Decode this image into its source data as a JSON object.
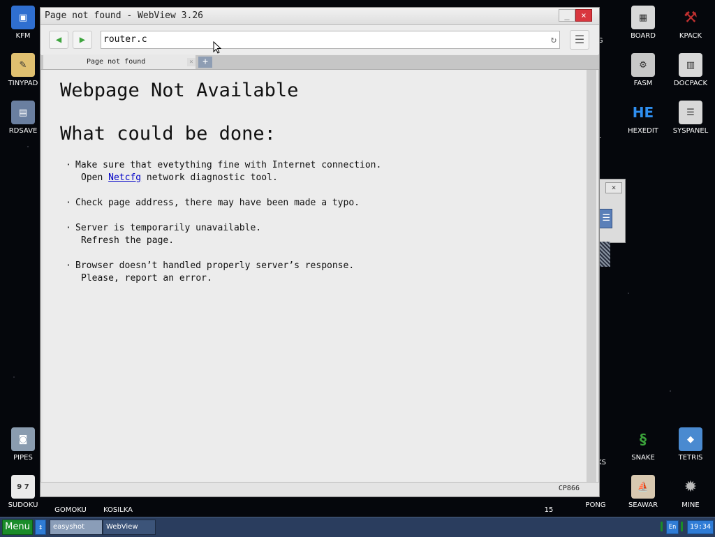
{
  "desktop": {
    "icons_left": [
      {
        "label": "KFM",
        "icon": "floppy-disk-icon",
        "color": "#2f6fd0"
      },
      {
        "label": "TINYPAD",
        "icon": "notepad-icon",
        "color": "#e0c070"
      },
      {
        "label": "RDSAVE",
        "icon": "ramdisk-save-icon",
        "color": "#6a7fa0"
      },
      {
        "label": "PIPES",
        "icon": "pipes-game-icon",
        "color": "#8a9caf"
      },
      {
        "label": "SUDOKU",
        "icon": "sudoku-grid-icon",
        "color": "#eaeaea"
      }
    ],
    "icons_right": [
      {
        "label": "BOARD",
        "icon": "board-icon",
        "color": "#d8d8d8"
      },
      {
        "label": "KPACK",
        "icon": "hammer-pack-icon",
        "color": "#c03030"
      },
      {
        "label": "FASM",
        "icon": "fasm-icon",
        "color": "#c8c8c8"
      },
      {
        "label": "DOCPACK",
        "icon": "cabinet-icon",
        "color": "#d8d8d8"
      },
      {
        "label": "HEXEDIT",
        "icon": "hexedit-icon",
        "color": "#2f6fd0",
        "glyph": "HE"
      },
      {
        "label": "SYSPANEL",
        "icon": "sliders-icon",
        "color": "#d8d8d8"
      },
      {
        "label": "SNAKE",
        "icon": "snake-icon",
        "color": "#3aa03a"
      },
      {
        "label": "TETRIS",
        "icon": "tetris-cube-icon",
        "color": "#4a8ad0"
      },
      {
        "label": "PONG",
        "icon": "pong-icon",
        "color": "#d8d8d8"
      },
      {
        "label": "SEAWAR",
        "icon": "ship-icon",
        "color": "#d8c8b0"
      },
      {
        "label": "MINE",
        "icon": "mine-icon",
        "color": "#a0a0a0"
      }
    ],
    "partial_labels": [
      "UG",
      "F",
      "LL",
      "CKS",
      "15",
      "GOMOKU",
      "KOSILKA"
    ]
  },
  "window": {
    "title": "Page not found - WebView 3.26",
    "minimize": "_",
    "close": "×",
    "toolbar": {
      "back_icon": "◀",
      "forward_icon": "▶",
      "url_value": "router.c",
      "reload_icon": "↻",
      "menu_icon": "☰"
    },
    "tabs": [
      {
        "label": "Page not found",
        "close": "×"
      }
    ],
    "new_tab": "+",
    "page": {
      "heading": "Webpage Not Available",
      "subheading": "What could be done:",
      "bullet": "·",
      "tip1_line1": "Make sure that evetything fine with Internet connection.",
      "tip1_line2_pre": "Open ",
      "tip1_link": "Netcfg",
      "tip1_line2_post": " network diagnostic tool.",
      "tip2_line1": "Check page address, there may have been made a typo.",
      "tip3_line1": "Server is temporarily unavailable.",
      "tip3_line2": "Refresh the page.",
      "tip4_line1": "Browser doesn’t handled properly server’s response.",
      "tip4_line2": "Please, report an error."
    },
    "status": {
      "encoding": "CP866"
    }
  },
  "background_window": {
    "close": "×",
    "button_glyph": "☰"
  },
  "taskbar": {
    "menu_label": "Menu",
    "switch_icon": "↕",
    "tasks": [
      "easyshot",
      "WebView"
    ],
    "lang": "En",
    "time": "19:34"
  }
}
